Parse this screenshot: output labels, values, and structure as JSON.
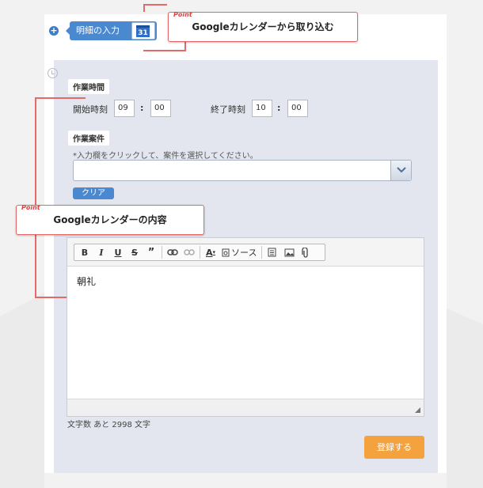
{
  "tab": {
    "label": "明細の入力",
    "calendar_day": "31"
  },
  "callouts": {
    "point_label": "Point",
    "import_text": "Googleカレンダーから取り込む",
    "content_text": "Googleカレンダーの内容"
  },
  "work_time": {
    "section_label": "作業時間",
    "start_label": "開始時刻",
    "start_hour": "09",
    "start_minute": "00",
    "end_label": "終了時刻",
    "end_hour": "10",
    "end_minute": "00",
    "colon": ":"
  },
  "work_case": {
    "section_label": "作業案件",
    "note": "*入力欄をクリックして、案件を選択してください。",
    "selected_value": "",
    "clear_label": "クリア"
  },
  "editor": {
    "toolbar": {
      "bold": "B",
      "italic": "I",
      "underline": "U",
      "strike": "S",
      "quote": "”",
      "font_color": "A",
      "source": "ソース"
    },
    "content": "朝礼",
    "char_count": "文字数 あと 2998 文字"
  },
  "submit_label": "登録する",
  "colors": {
    "accent_blue": "#4a88cf",
    "callout_red": "#e26a6a",
    "submit_orange": "#f4a23e",
    "panel_bg": "#e3e6ee"
  }
}
